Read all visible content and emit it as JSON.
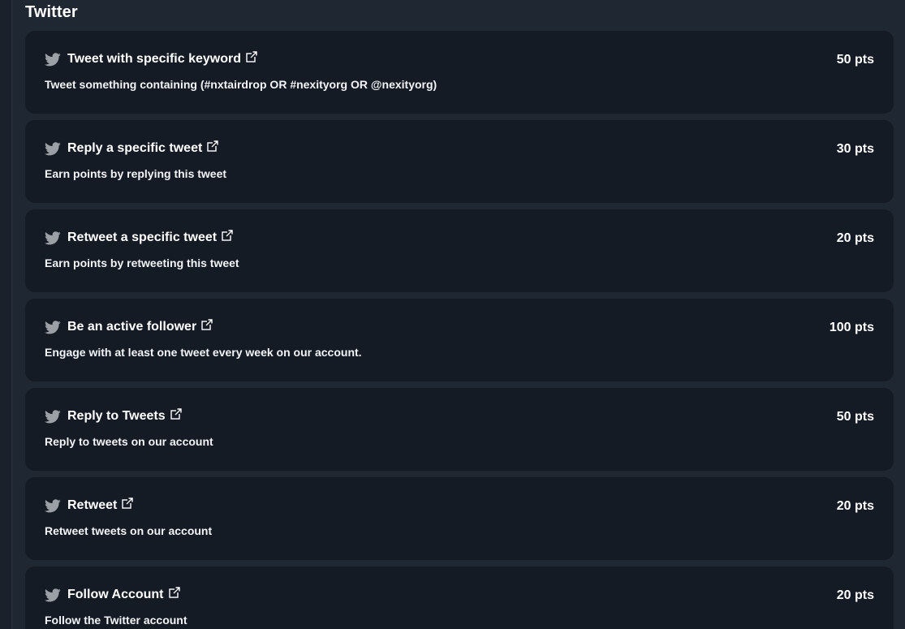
{
  "section": {
    "title": "Twitter"
  },
  "tasks": [
    {
      "title": "Tweet with specific keyword",
      "description": "Tweet something containing (#nxtairdrop OR #nexityorg OR @nexityorg)",
      "points": "50 pts"
    },
    {
      "title": "Reply a specific tweet",
      "description": "Earn points by replying this tweet",
      "points": "30 pts"
    },
    {
      "title": "Retweet a specific tweet",
      "description": "Earn points by retweeting this tweet",
      "points": "20 pts"
    },
    {
      "title": "Be an active follower",
      "description": "Engage with at least one tweet every week on our account.",
      "points": "100 pts"
    },
    {
      "title": "Reply to Tweets",
      "description": "Reply to tweets on our account",
      "points": "50 pts"
    },
    {
      "title": "Retweet",
      "description": "Retweet tweets on our account",
      "points": "20 pts"
    },
    {
      "title": "Follow Account",
      "description": "Follow the Twitter account",
      "points": "20 pts"
    }
  ],
  "icons": {
    "task_icon": "twitter-bird-icon",
    "link_icon": "external-link-icon"
  },
  "colors": {
    "background": "#1f2733",
    "card": "#151b24",
    "text": "#ffffff",
    "icon": "#9aa0a6"
  }
}
